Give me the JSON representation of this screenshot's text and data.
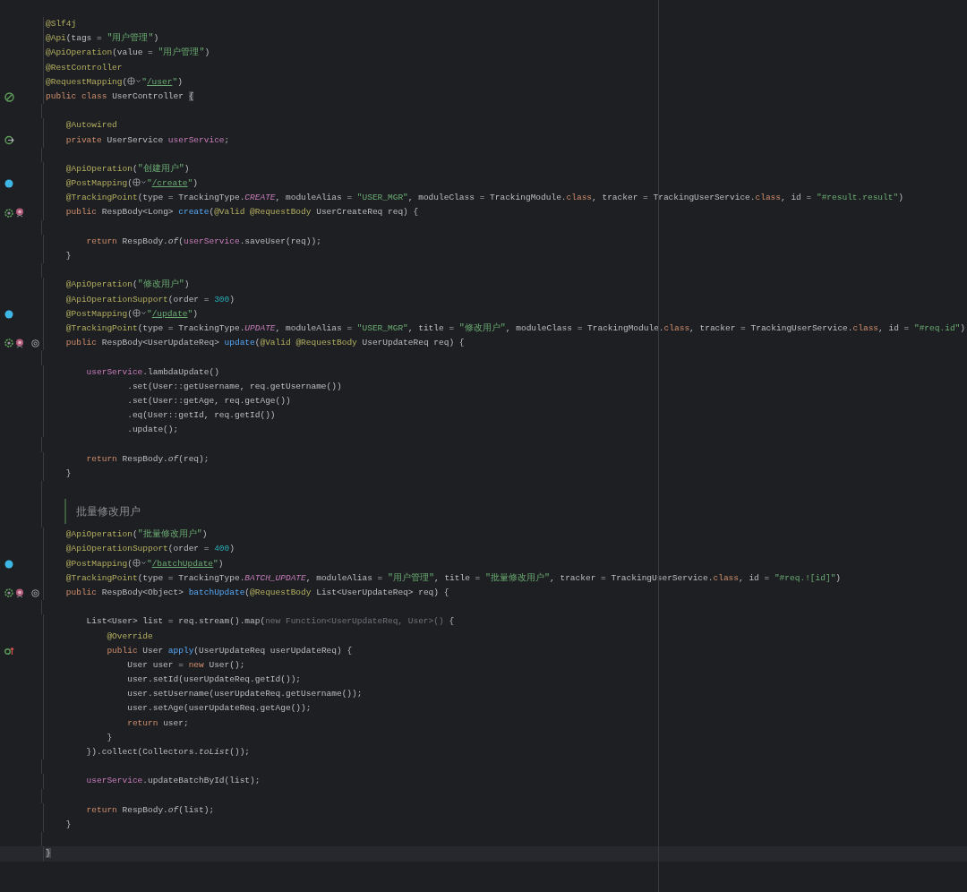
{
  "editor": {
    "lines": [
      {
        "kind": "code",
        "current": false,
        "tokens": [
          {
            "text": "@Slf4j",
            "kind": "ann"
          }
        ]
      },
      {
        "kind": "code",
        "current": false,
        "tokens": [
          {
            "text": "@Api",
            "kind": "ann"
          },
          {
            "text": "(tags = ",
            "kind": "plain"
          },
          {
            "text": "\"用户管理\"",
            "kind": "str-cjk"
          },
          {
            "text": ")",
            "kind": "plain"
          }
        ]
      },
      {
        "kind": "code",
        "current": false,
        "tokens": [
          {
            "text": "@ApiOperation",
            "kind": "ann"
          },
          {
            "text": "(value = ",
            "kind": "plain"
          },
          {
            "text": "\"用户管理\"",
            "kind": "str-cjk"
          },
          {
            "text": ")",
            "kind": "plain"
          }
        ]
      },
      {
        "kind": "code",
        "current": false,
        "tokens": [
          {
            "text": "@RestController",
            "kind": "ann"
          }
        ]
      },
      {
        "kind": "code",
        "current": false,
        "tokens": [
          {
            "text": "@RequestMapping",
            "kind": "ann"
          },
          {
            "text": "(",
            "kind": "plain"
          },
          {
            "kind": "globe-inlay"
          },
          {
            "text": "\"",
            "kind": "str"
          },
          {
            "text": "/user",
            "kind": "url"
          },
          {
            "text": "\"",
            "kind": "str"
          },
          {
            "text": ")",
            "kind": "plain"
          }
        ]
      },
      {
        "kind": "code",
        "current": false,
        "gutter": [
          {
            "kind": "bean"
          }
        ],
        "tokens": [
          {
            "text": "public class ",
            "kind": "kw"
          },
          {
            "text": "UserController ",
            "kind": "plain"
          },
          {
            "text": "{",
            "kind": "brace"
          }
        ]
      },
      {
        "kind": "blank",
        "current": false
      },
      {
        "kind": "code",
        "current": false,
        "tokens": [
          {
            "text": "    @Autowired",
            "kind": "ann"
          }
        ]
      },
      {
        "kind": "code",
        "current": false,
        "gutter": [
          {
            "kind": "inject"
          }
        ],
        "tokens": [
          {
            "text": "    private ",
            "kind": "kw"
          },
          {
            "text": "UserService ",
            "kind": "plain"
          },
          {
            "text": "userService",
            "kind": "fld"
          },
          {
            "text": ";",
            "kind": "plain"
          }
        ]
      },
      {
        "kind": "blank",
        "current": false
      },
      {
        "kind": "code",
        "current": false,
        "tokens": [
          {
            "text": "    @ApiOperation",
            "kind": "ann"
          },
          {
            "text": "(",
            "kind": "plain"
          },
          {
            "text": "\"创建用户\"",
            "kind": "str-cjk"
          },
          {
            "text": ")",
            "kind": "plain"
          }
        ]
      },
      {
        "kind": "code",
        "current": false,
        "gutter": [
          {
            "kind": "endpoint"
          }
        ],
        "tokens": [
          {
            "text": "    @PostMapping",
            "kind": "ann"
          },
          {
            "text": "(",
            "kind": "plain"
          },
          {
            "kind": "globe-inlay"
          },
          {
            "text": "\"",
            "kind": "str"
          },
          {
            "text": "/create",
            "kind": "url"
          },
          {
            "text": "\"",
            "kind": "str"
          },
          {
            "text": ")",
            "kind": "plain"
          }
        ]
      },
      {
        "kind": "code",
        "current": false,
        "tokens": [
          {
            "text": "    @TrackingPoint",
            "kind": "ann"
          },
          {
            "text": "(type = TrackingType.",
            "kind": "plain"
          },
          {
            "text": "CREATE",
            "kind": "const"
          },
          {
            "text": ", moduleAlias = ",
            "kind": "plain"
          },
          {
            "text": "\"USER_MGR\"",
            "kind": "str"
          },
          {
            "text": ", moduleClass = TrackingModule.",
            "kind": "plain"
          },
          {
            "text": "class",
            "kind": "kw"
          },
          {
            "text": ", tracker = TrackingUserService.",
            "kind": "plain"
          },
          {
            "text": "class",
            "kind": "kw"
          },
          {
            "text": ", id = ",
            "kind": "plain"
          },
          {
            "text": "\"#result.result\"",
            "kind": "str"
          },
          {
            "text": ")",
            "kind": "plain"
          }
        ]
      },
      {
        "kind": "code",
        "current": false,
        "gutter": [
          {
            "kind": "bean-small"
          },
          {
            "kind": "mapper"
          }
        ],
        "tokens": [
          {
            "text": "    public ",
            "kind": "kw"
          },
          {
            "text": "RespBody<Long> ",
            "kind": "plain"
          },
          {
            "text": "create",
            "kind": "fn"
          },
          {
            "text": "(",
            "kind": "plain"
          },
          {
            "text": "@Valid @RequestBody",
            "kind": "ann"
          },
          {
            "text": " UserCreateReq req) {",
            "kind": "plain"
          }
        ]
      },
      {
        "kind": "blank",
        "current": false
      },
      {
        "kind": "code",
        "current": false,
        "tokens": [
          {
            "text": "        return ",
            "kind": "kw"
          },
          {
            "text": "RespBody.",
            "kind": "plain"
          },
          {
            "text": "of",
            "kind": "it"
          },
          {
            "text": "(",
            "kind": "plain"
          },
          {
            "text": "userService",
            "kind": "fld"
          },
          {
            "text": ".saveUser(req));",
            "kind": "plain"
          }
        ]
      },
      {
        "kind": "code",
        "current": false,
        "tokens": [
          {
            "text": "    }",
            "kind": "plain"
          }
        ]
      },
      {
        "kind": "blank",
        "current": false
      },
      {
        "kind": "code",
        "current": false,
        "tokens": [
          {
            "text": "    @ApiOperation",
            "kind": "ann"
          },
          {
            "text": "(",
            "kind": "plain"
          },
          {
            "text": "\"修改用户\"",
            "kind": "str-cjk"
          },
          {
            "text": ")",
            "kind": "plain"
          }
        ]
      },
      {
        "kind": "code",
        "current": false,
        "tokens": [
          {
            "text": "    @ApiOperationSupport",
            "kind": "ann"
          },
          {
            "text": "(order = ",
            "kind": "plain"
          },
          {
            "text": "300",
            "kind": "num"
          },
          {
            "text": ")",
            "kind": "plain"
          }
        ]
      },
      {
        "kind": "code",
        "current": false,
        "gutter": [
          {
            "kind": "endpoint"
          }
        ],
        "tokens": [
          {
            "text": "    @PostMapping",
            "kind": "ann"
          },
          {
            "text": "(",
            "kind": "plain"
          },
          {
            "kind": "globe-inlay"
          },
          {
            "text": "\"",
            "kind": "str"
          },
          {
            "text": "/update",
            "kind": "url"
          },
          {
            "text": "\"",
            "kind": "str"
          },
          {
            "text": ")",
            "kind": "plain"
          }
        ]
      },
      {
        "kind": "code",
        "current": false,
        "tokens": [
          {
            "text": "    @TrackingPoint",
            "kind": "ann"
          },
          {
            "text": "(type = TrackingType.",
            "kind": "plain"
          },
          {
            "text": "UPDATE",
            "kind": "const"
          },
          {
            "text": ", moduleAlias = ",
            "kind": "plain"
          },
          {
            "text": "\"USER_MGR\"",
            "kind": "str"
          },
          {
            "text": ", title = ",
            "kind": "plain"
          },
          {
            "text": "\"修改用户\"",
            "kind": "str-cjk"
          },
          {
            "text": ", moduleClass = TrackingModule.",
            "kind": "plain"
          },
          {
            "text": "class",
            "kind": "kw"
          },
          {
            "text": ", tracker = TrackingUserService.",
            "kind": "plain"
          },
          {
            "text": "class",
            "kind": "kw"
          },
          {
            "text": ", id = ",
            "kind": "plain"
          },
          {
            "text": "\"#req.id\"",
            "kind": "str"
          },
          {
            "text": ")",
            "kind": "plain"
          }
        ]
      },
      {
        "kind": "code",
        "current": false,
        "gutter": [
          {
            "kind": "bean-small"
          },
          {
            "kind": "mapper"
          },
          {
            "kind": "at"
          }
        ],
        "tokens": [
          {
            "text": "    public ",
            "kind": "kw"
          },
          {
            "text": "RespBody<UserUpdateReq> ",
            "kind": "plain"
          },
          {
            "text": "update",
            "kind": "fn"
          },
          {
            "text": "(",
            "kind": "plain"
          },
          {
            "text": "@Valid @RequestBody",
            "kind": "ann"
          },
          {
            "text": " UserUpdateReq req) {",
            "kind": "plain"
          }
        ]
      },
      {
        "kind": "blank",
        "current": false
      },
      {
        "kind": "code",
        "current": false,
        "tokens": [
          {
            "text": "        userService",
            "kind": "fld"
          },
          {
            "text": ".lambdaUpdate()",
            "kind": "plain"
          }
        ]
      },
      {
        "kind": "code",
        "current": false,
        "tokens": [
          {
            "text": "                .set(User::getUsername, req.getUsername())",
            "kind": "plain"
          }
        ]
      },
      {
        "kind": "code",
        "current": false,
        "tokens": [
          {
            "text": "                .set(User::getAge, req.getAge())",
            "kind": "plain"
          }
        ]
      },
      {
        "kind": "code",
        "current": false,
        "tokens": [
          {
            "text": "                .eq(User::getId, req.getId())",
            "kind": "plain"
          }
        ]
      },
      {
        "kind": "code",
        "current": false,
        "tokens": [
          {
            "text": "                .update();",
            "kind": "plain"
          }
        ]
      },
      {
        "kind": "blank",
        "current": false
      },
      {
        "kind": "code",
        "current": false,
        "tokens": [
          {
            "text": "        return ",
            "kind": "kw"
          },
          {
            "text": "RespBody.",
            "kind": "plain"
          },
          {
            "text": "of",
            "kind": "it"
          },
          {
            "text": "(req);",
            "kind": "plain"
          }
        ]
      },
      {
        "kind": "code",
        "current": false,
        "tokens": [
          {
            "text": "    }",
            "kind": "plain"
          }
        ]
      },
      {
        "kind": "blank",
        "current": false
      },
      {
        "kind": "doc",
        "current": false,
        "tokens": [
          {
            "text": "批量修改用户",
            "kind": "doc"
          }
        ]
      },
      {
        "kind": "code",
        "current": false,
        "tokens": [
          {
            "text": "    @ApiOperation",
            "kind": "ann"
          },
          {
            "text": "(",
            "kind": "plain"
          },
          {
            "text": "\"批量修改用户\"",
            "kind": "str-cjk"
          },
          {
            "text": ")",
            "kind": "plain"
          }
        ]
      },
      {
        "kind": "code",
        "current": false,
        "tokens": [
          {
            "text": "    @ApiOperationSupport",
            "kind": "ann"
          },
          {
            "text": "(order = ",
            "kind": "plain"
          },
          {
            "text": "400",
            "kind": "num"
          },
          {
            "text": ")",
            "kind": "plain"
          }
        ]
      },
      {
        "kind": "code",
        "current": false,
        "gutter": [
          {
            "kind": "endpoint"
          }
        ],
        "tokens": [
          {
            "text": "    @PostMapping",
            "kind": "ann"
          },
          {
            "text": "(",
            "kind": "plain"
          },
          {
            "kind": "globe-inlay"
          },
          {
            "text": "\"",
            "kind": "str"
          },
          {
            "text": "/batchUpdate",
            "kind": "url"
          },
          {
            "text": "\"",
            "kind": "str"
          },
          {
            "text": ")",
            "kind": "plain"
          }
        ]
      },
      {
        "kind": "code",
        "current": false,
        "tokens": [
          {
            "text": "    @TrackingPoint",
            "kind": "ann"
          },
          {
            "text": "(type = TrackingType.",
            "kind": "plain"
          },
          {
            "text": "BATCH_UPDATE",
            "kind": "const"
          },
          {
            "text": ", moduleAlias = ",
            "kind": "plain"
          },
          {
            "text": "\"用户管理\"",
            "kind": "str-cjk"
          },
          {
            "text": ", title = ",
            "kind": "plain"
          },
          {
            "text": "\"批量修改用户\"",
            "kind": "str-cjk"
          },
          {
            "text": ", tracker = TrackingUserService.",
            "kind": "plain"
          },
          {
            "text": "class",
            "kind": "kw"
          },
          {
            "text": ", id = ",
            "kind": "plain"
          },
          {
            "text": "\"#req.![id]\"",
            "kind": "str"
          },
          {
            "text": ")",
            "kind": "plain"
          }
        ]
      },
      {
        "kind": "code",
        "current": false,
        "gutter": [
          {
            "kind": "bean-small"
          },
          {
            "kind": "mapper"
          },
          {
            "kind": "at"
          }
        ],
        "tokens": [
          {
            "text": "    public ",
            "kind": "kw"
          },
          {
            "text": "RespBody<Object> ",
            "kind": "plain"
          },
          {
            "text": "batchUpdate",
            "kind": "fn"
          },
          {
            "text": "(",
            "kind": "plain"
          },
          {
            "text": "@RequestBody",
            "kind": "ann"
          },
          {
            "text": " List<UserUpdateReq> req) {",
            "kind": "plain"
          }
        ]
      },
      {
        "kind": "blank",
        "current": false
      },
      {
        "kind": "code",
        "current": false,
        "tokens": [
          {
            "text": "        List<User> list = req.stream().map(",
            "kind": "plain"
          },
          {
            "text": "new Function<UserUpdateReq, User>() ",
            "kind": "dim"
          },
          {
            "text": "{",
            "kind": "plain"
          }
        ]
      },
      {
        "kind": "code",
        "current": false,
        "tokens": [
          {
            "text": "            @Override",
            "kind": "ann"
          }
        ]
      },
      {
        "kind": "code",
        "current": false,
        "gutter": [
          {
            "kind": "override"
          }
        ],
        "tokens": [
          {
            "text": "            public ",
            "kind": "kw"
          },
          {
            "text": "User ",
            "kind": "plain"
          },
          {
            "text": "apply",
            "kind": "fn"
          },
          {
            "text": "(UserUpdateReq userUpdateReq) {",
            "kind": "plain"
          }
        ]
      },
      {
        "kind": "code",
        "current": false,
        "tokens": [
          {
            "text": "                User user = ",
            "kind": "plain"
          },
          {
            "text": "new",
            "kind": "kw"
          },
          {
            "text": " User();",
            "kind": "plain"
          }
        ]
      },
      {
        "kind": "code",
        "current": false,
        "tokens": [
          {
            "text": "                user.setId(userUpdateReq.getId());",
            "kind": "plain"
          }
        ]
      },
      {
        "kind": "code",
        "current": false,
        "tokens": [
          {
            "text": "                user.setUsername(userUpdateReq.getUsername());",
            "kind": "plain"
          }
        ]
      },
      {
        "kind": "code",
        "current": false,
        "tokens": [
          {
            "text": "                user.setAge(userUpdateReq.getAge());",
            "kind": "plain"
          }
        ]
      },
      {
        "kind": "code",
        "current": false,
        "tokens": [
          {
            "text": "                return ",
            "kind": "kw"
          },
          {
            "text": "user;",
            "kind": "plain"
          }
        ]
      },
      {
        "kind": "code",
        "current": false,
        "tokens": [
          {
            "text": "            }",
            "kind": "plain"
          }
        ]
      },
      {
        "kind": "code",
        "current": false,
        "tokens": [
          {
            "text": "        }).collect(Collectors.",
            "kind": "plain"
          },
          {
            "text": "toList",
            "kind": "it"
          },
          {
            "text": "());",
            "kind": "plain"
          }
        ]
      },
      {
        "kind": "blank",
        "current": false
      },
      {
        "kind": "code",
        "current": false,
        "tokens": [
          {
            "text": "        userService",
            "kind": "fld"
          },
          {
            "text": ".updateBatchById(list);",
            "kind": "plain"
          }
        ]
      },
      {
        "kind": "blank",
        "current": false
      },
      {
        "kind": "code",
        "current": false,
        "tokens": [
          {
            "text": "        return ",
            "kind": "kw"
          },
          {
            "text": "RespBody.",
            "kind": "plain"
          },
          {
            "text": "of",
            "kind": "it"
          },
          {
            "text": "(list);",
            "kind": "plain"
          }
        ]
      },
      {
        "kind": "code",
        "current": false,
        "tokens": [
          {
            "text": "    }",
            "kind": "plain"
          }
        ]
      },
      {
        "kind": "blank",
        "current": false
      },
      {
        "kind": "code",
        "current": true,
        "tokens": [
          {
            "text": "}",
            "kind": "brace"
          }
        ]
      }
    ]
  }
}
